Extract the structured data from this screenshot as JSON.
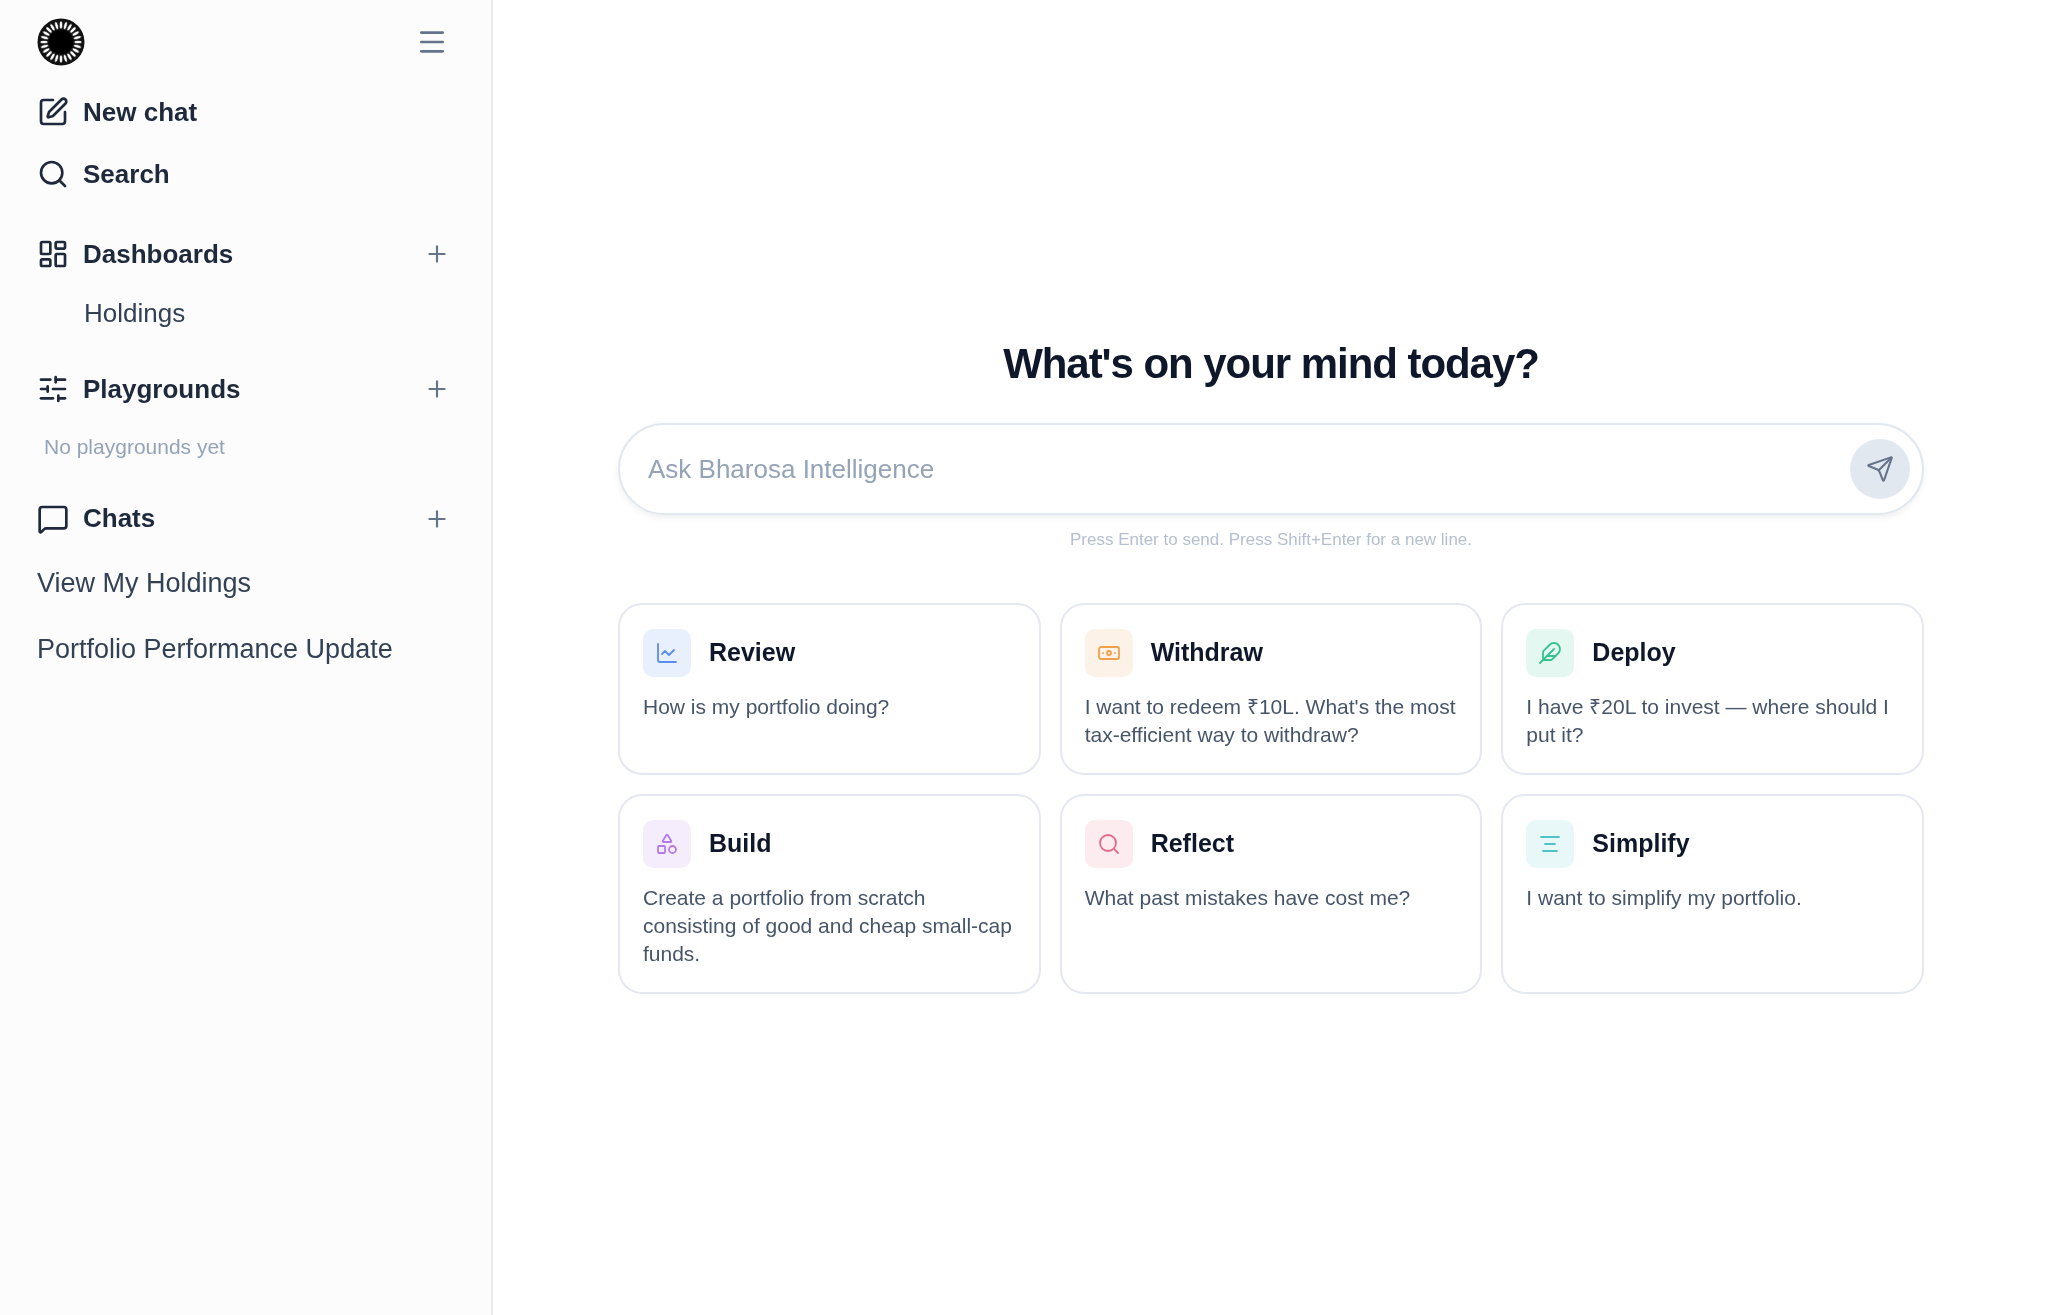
{
  "sidebar": {
    "nav": [
      {
        "kind": "new-chat",
        "label": "New chat"
      },
      {
        "kind": "search",
        "label": "Search"
      }
    ],
    "sections": [
      {
        "kind": "dashboards",
        "title": "Dashboards",
        "items": [
          {
            "label": "Holdings"
          }
        ]
      },
      {
        "kind": "playgrounds",
        "title": "Playgrounds",
        "empty_text": "No playgrounds yet"
      },
      {
        "kind": "chats",
        "title": "Chats",
        "chats": [
          {
            "label": "View My Holdings"
          },
          {
            "label": "Portfolio Performance Update"
          }
        ]
      }
    ]
  },
  "main": {
    "heading": "What's on your mind today?",
    "input": {
      "placeholder": "Ask Bharosa Intelligence"
    },
    "hint": "Press Enter to send. Press Shift+Enter for a new line.",
    "cards": [
      {
        "kind": "review",
        "color": "#5b8def",
        "title": "Review",
        "prompt": "How is my portfolio doing?"
      },
      {
        "kind": "withdraw",
        "color": "#f0a04b",
        "title": "Withdraw",
        "prompt": "I want to redeem ₹10L. What's the most tax-efficient way to withdraw?"
      },
      {
        "kind": "deploy",
        "color": "#34c38f",
        "title": "Deploy",
        "prompt": "I have ₹20L to invest — where should I put it?"
      },
      {
        "kind": "build",
        "color": "#b57ae8",
        "title": "Build",
        "prompt": "Create a portfolio from scratch consisting of good and cheap small-cap funds."
      },
      {
        "kind": "reflect",
        "color": "#e56b8a",
        "title": "Reflect",
        "prompt": "What past mistakes have cost me?"
      },
      {
        "kind": "simplify",
        "color": "#4fc3c7",
        "title": "Simplify",
        "prompt": "I want to simplify my portfolio."
      }
    ]
  }
}
